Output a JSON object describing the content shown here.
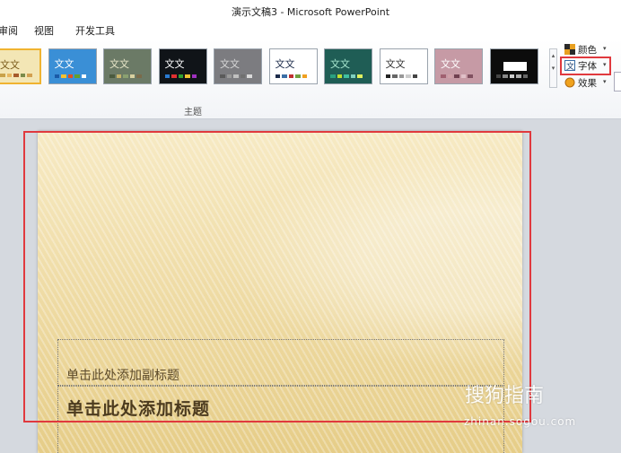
{
  "window": {
    "title": "演示文稿3 - Microsoft PowerPoint"
  },
  "tabs": [
    "审阅",
    "视图",
    "开发工具"
  ],
  "ribbon": {
    "themes_group_label": "主题",
    "themes": [
      {
        "label": "文文",
        "bg": "#f3e6b5",
        "fg": "#7a5a1a",
        "selected": true
      },
      {
        "label": "文文",
        "bg": "#3a8fd6",
        "fg": "#ffffff"
      },
      {
        "label": "文文",
        "bg": "#6b7a66",
        "fg": "#e8e6c8"
      },
      {
        "label": "文文",
        "bg": "#101418",
        "fg": "#ffffff"
      },
      {
        "label": "文文",
        "bg": "#7c7c80",
        "fg": "#d8d8d8"
      },
      {
        "label": "文文",
        "bg": "#ffffff",
        "fg": "#1c2b4a"
      },
      {
        "label": "文文",
        "bg": "#1f5d55",
        "fg": "#a8e8d0"
      },
      {
        "label": "文文",
        "bg": "#ffffff",
        "fg": "#333333"
      },
      {
        "label": "文文",
        "bg": "#c69aa5",
        "fg": "#ffffff"
      },
      {
        "label": "",
        "bg": "#0c0c0c",
        "fg": "#ffffff"
      }
    ],
    "theme_menu": {
      "colors_label": "颜色",
      "fonts_label": "字体",
      "effects_label": "效果"
    }
  },
  "slide": {
    "subtitle_placeholder": "单击此处添加副标题",
    "title_placeholder": "单击此处添加标题"
  },
  "watermark": {
    "brand": "搜狗指南",
    "url": "zhinan.sogou.com"
  },
  "colors": {
    "highlight": "#e0393e",
    "slide_base": "#eedaa2"
  }
}
